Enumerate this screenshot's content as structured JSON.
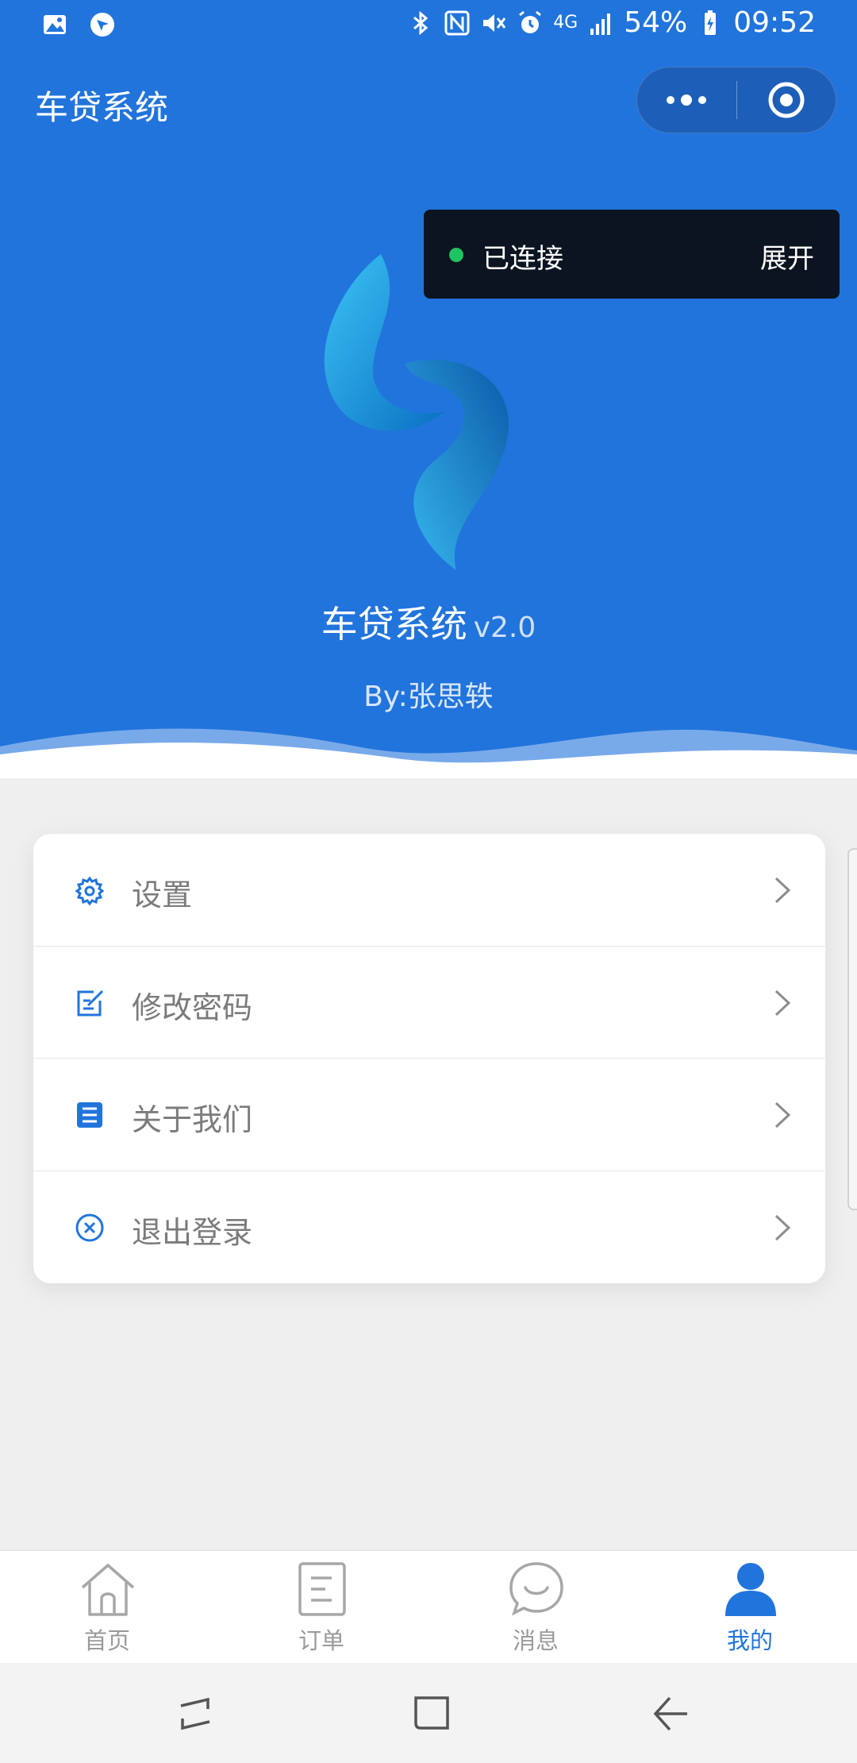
{
  "status_bar": {
    "battery": "54%",
    "time": "09:52",
    "network": "4G"
  },
  "header": {
    "title": "车贷系统"
  },
  "toast": {
    "status": "已连接",
    "action": "展开",
    "status_color": "#1ec461"
  },
  "hero": {
    "app_name": "车贷系统",
    "version": "v2.0",
    "byline": "By:张思轶"
  },
  "menu": {
    "items": [
      {
        "label": "设置",
        "icon": "gear-icon"
      },
      {
        "label": "修改密码",
        "icon": "edit-icon"
      },
      {
        "label": "关于我们",
        "icon": "document-icon"
      },
      {
        "label": "退出登录",
        "icon": "close-circle-icon"
      }
    ]
  },
  "tabbar": {
    "tabs": [
      {
        "label": "首页",
        "icon": "home-icon"
      },
      {
        "label": "订单",
        "icon": "order-icon"
      },
      {
        "label": "消息",
        "icon": "message-icon"
      },
      {
        "label": "我的",
        "icon": "user-icon",
        "active": true
      }
    ]
  },
  "colors": {
    "brand": "#2174db",
    "text_muted": "#7b7b7b"
  }
}
